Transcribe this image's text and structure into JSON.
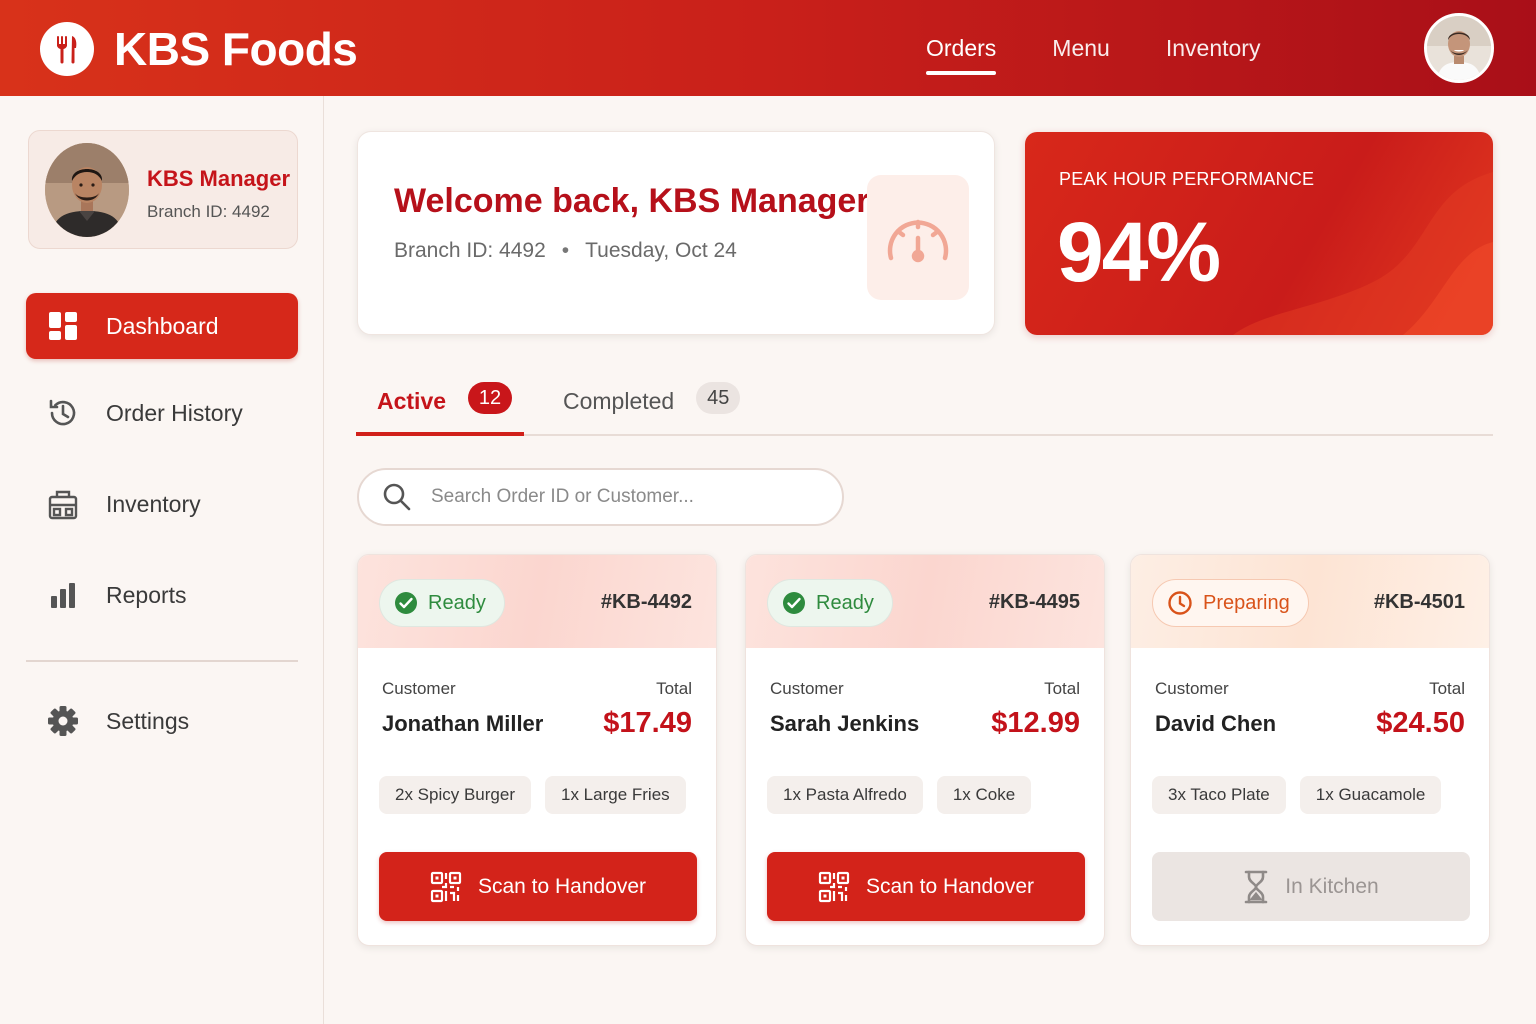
{
  "header": {
    "brand": "KBS Foods",
    "nav": [
      {
        "label": "Orders",
        "active": true
      },
      {
        "label": "Menu",
        "active": false
      },
      {
        "label": "Inventory",
        "active": false
      }
    ]
  },
  "sidebar": {
    "profile": {
      "name": "KBS Manager",
      "branch": "Branch ID: 4492"
    },
    "items": [
      {
        "label": "Dashboard",
        "icon": "grid-icon",
        "active": true
      },
      {
        "label": "Order History",
        "icon": "history-icon",
        "active": false
      },
      {
        "label": "Inventory",
        "icon": "inventory-icon",
        "active": false
      },
      {
        "label": "Reports",
        "icon": "bar-chart-icon",
        "active": false
      },
      {
        "label": "Settings",
        "icon": "gear-icon",
        "active": false
      }
    ]
  },
  "welcome": {
    "title": "Welcome back, KBS Manager",
    "branch": "Branch ID: 4492",
    "separator": "•",
    "date": "Tuesday, Oct 24",
    "icon": "speedometer-icon"
  },
  "peak": {
    "label": "PEAK HOUR PERFORMANCE",
    "value": "94%"
  },
  "tabs": [
    {
      "label": "Active",
      "count": "12",
      "active": true
    },
    {
      "label": "Completed",
      "count": "45",
      "active": false
    }
  ],
  "search": {
    "placeholder": "Search Order ID or Customer...",
    "value": ""
  },
  "orders": [
    {
      "status": "Ready",
      "status_type": "ready",
      "id": "#KB-4492",
      "customer_label": "Customer",
      "total_label": "Total",
      "customer": "Jonathan Miller",
      "total": "$17.49",
      "items": [
        "2x Spicy Burger",
        "1x Large Fries"
      ],
      "action": "Scan to Handover",
      "action_icon": "qr-code-icon"
    },
    {
      "status": "Ready",
      "status_type": "ready",
      "id": "#KB-4495",
      "customer_label": "Customer",
      "total_label": "Total",
      "customer": "Sarah Jenkins",
      "total": "$12.99",
      "items": [
        "1x Pasta Alfredo",
        "1x Coke"
      ],
      "action": "Scan to Handover",
      "action_icon": "qr-code-icon"
    },
    {
      "status": "Preparing",
      "status_type": "preparing",
      "id": "#KB-4501",
      "customer_label": "Customer",
      "total_label": "Total",
      "customer": "David Chen",
      "total": "$24.50",
      "items": [
        "3x Taco Plate",
        "1x Guacamole"
      ],
      "action": "In Kitchen",
      "action_icon": "hourglass-icon"
    }
  ],
  "colors": {
    "brand_red": "#d3231a",
    "ready_green": "#2e8b3e",
    "preparing_orange": "#d9531a"
  }
}
